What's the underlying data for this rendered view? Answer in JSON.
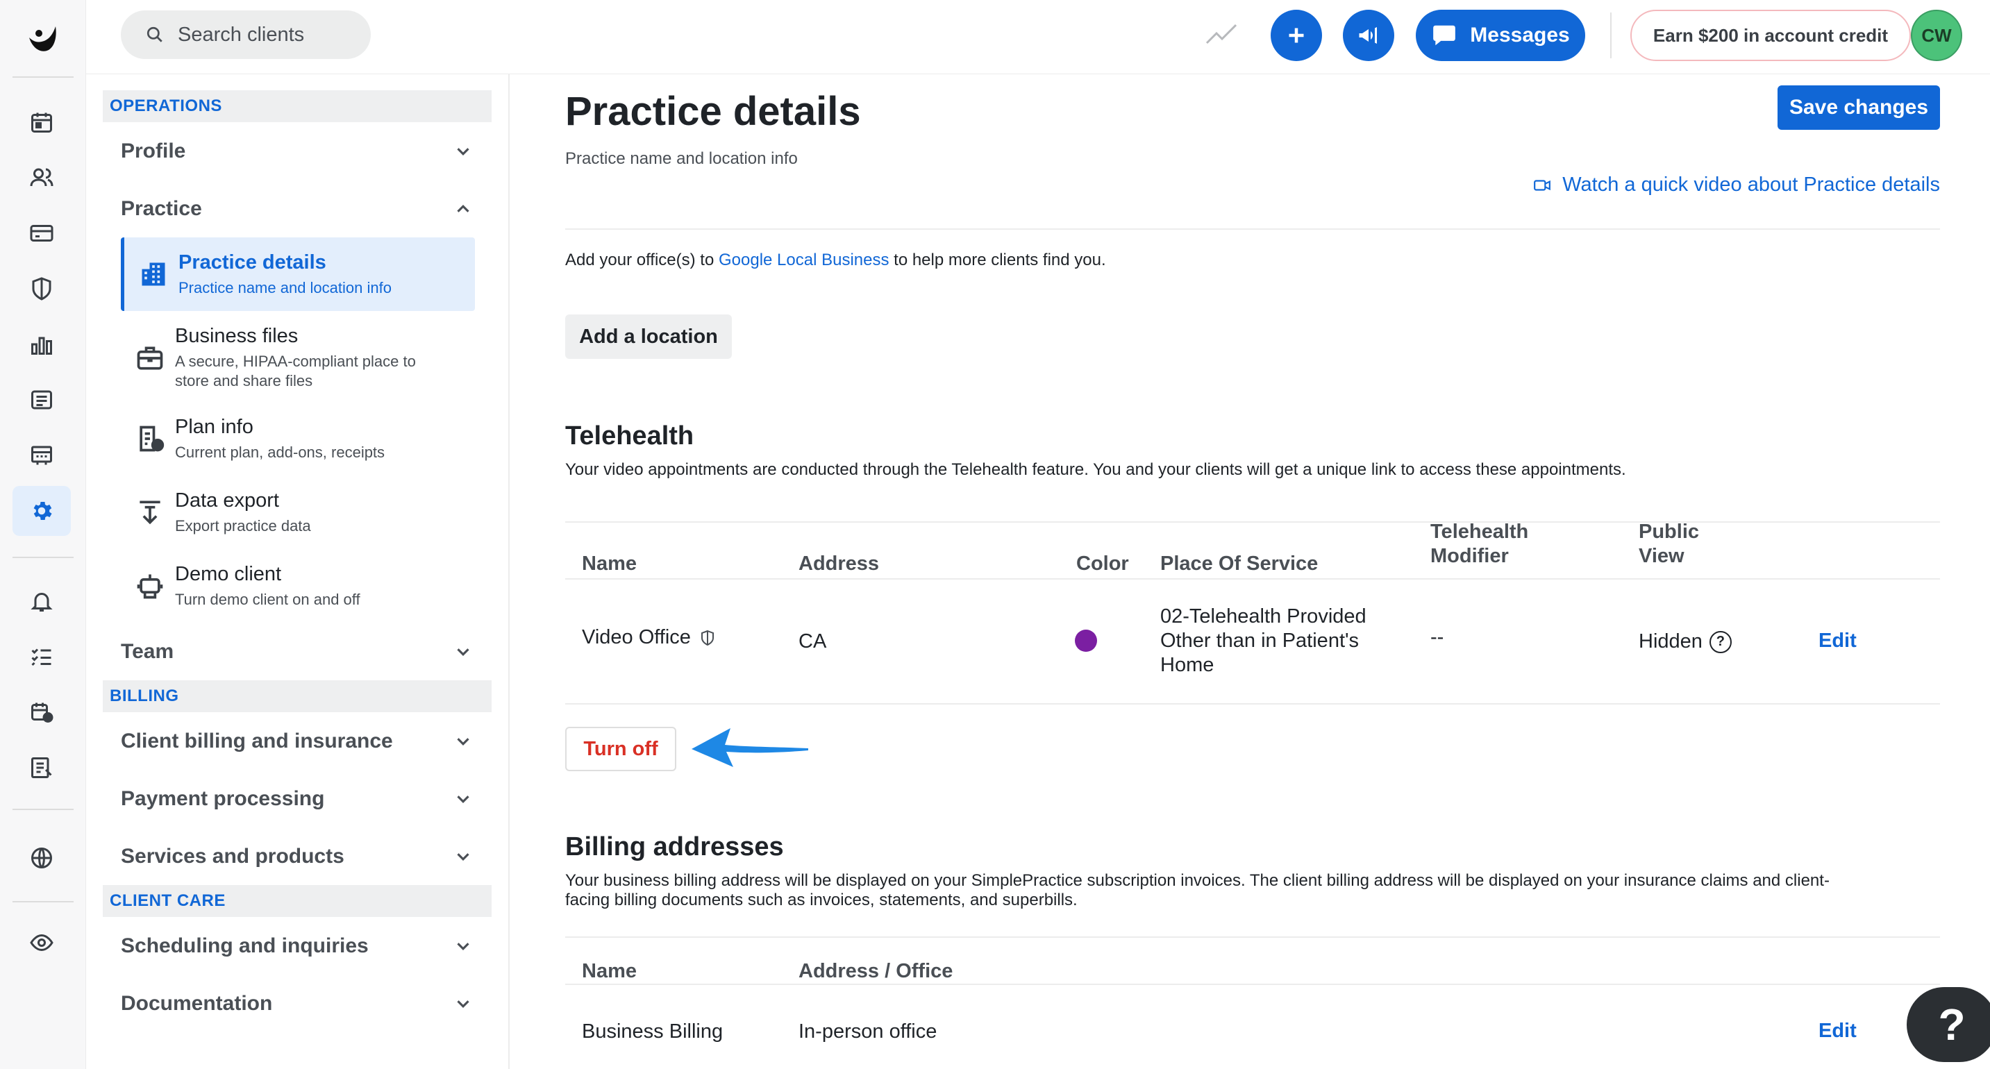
{
  "topbar": {
    "search_placeholder": "Search clients",
    "messages_label": "Messages",
    "credit_label": "Earn $200 in account credit",
    "avatar_initials": "CW"
  },
  "sidebar_nav": {
    "sections": [
      {
        "head": "OPERATIONS"
      },
      {
        "head": "BILLING"
      },
      {
        "head": "CLIENT CARE"
      }
    ],
    "groups": {
      "profile": "Profile",
      "practice": "Practice",
      "team": "Team",
      "client_billing": "Client billing and insurance",
      "payment_processing": "Payment processing",
      "services_products": "Services and products",
      "scheduling": "Scheduling and inquiries",
      "documentation": "Documentation"
    },
    "practice_items": [
      {
        "title": "Practice details",
        "desc": "Practice name and location info",
        "icon": "building-icon"
      },
      {
        "title": "Business files",
        "desc": "A secure, HIPAA-compliant place to store and share files",
        "icon": "briefcase-icon"
      },
      {
        "title": "Plan info",
        "desc": "Current plan, add-ons, receipts",
        "icon": "receipt-icon"
      },
      {
        "title": "Data export",
        "desc": "Export practice data",
        "icon": "download-icon"
      },
      {
        "title": "Demo client",
        "desc": "Turn demo client on and off",
        "icon": "robot-icon"
      }
    ]
  },
  "main": {
    "title": "Practice details",
    "subtitle": "Practice name and location info",
    "save_label": "Save changes",
    "video_link": "Watch a quick video about Practice details",
    "google_prefix": "Add your office(s) to ",
    "google_link": "Google Local Business",
    "google_suffix": " to help more clients find you.",
    "add_location": "Add a location",
    "telehealth": {
      "title": "Telehealth",
      "desc": "Your video appointments are conducted through the Telehealth feature. You and your clients will get a unique link to access these appointments.",
      "headers": {
        "name": "Name",
        "address": "Address",
        "color": "Color",
        "pos": "Place Of Service",
        "modifier_1": "Telehealth",
        "modifier_2": "Modifier",
        "public_1": "Public",
        "public_2": "View"
      },
      "row": {
        "name": "Video Office",
        "address": "CA",
        "color": "#7b1fa2",
        "pos_1": "02-Telehealth Provided",
        "pos_2": "Other than in Patient's",
        "pos_3": "Home",
        "modifier": "--",
        "public": "Hidden",
        "edit": "Edit"
      },
      "turn_off": "Turn off"
    },
    "billing": {
      "title": "Billing addresses",
      "desc_1": "Your business billing address will be displayed on your SimplePractice subscription invoices. The client billing address will be displayed on your insurance claims and client-",
      "desc_2": "facing billing documents such as invoices, statements, and superbills.",
      "headers": {
        "name": "Name",
        "address": "Address / Office"
      },
      "row": {
        "name": "Business Billing",
        "address": "In-person office",
        "edit": "Edit"
      }
    },
    "help": "?"
  },
  "colors": {
    "accent": "#1167d6",
    "danger": "#d93025",
    "arrow": "#1e88e5"
  }
}
